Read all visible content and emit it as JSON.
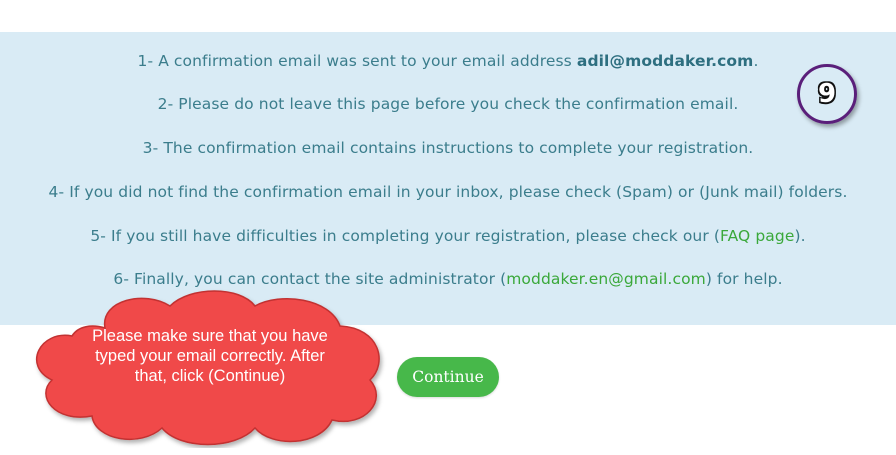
{
  "instructions": {
    "line1_text": "1- A confirmation email was sent to your email address ",
    "line1_email": "adil@moddaker.com",
    "line1_end": ".",
    "line2": "2- Please do not leave this page before you check the confirmation email.",
    "line3": "3- The confirmation email contains instructions to complete your registration.",
    "line4": "4- If you did not find the confirmation email in your inbox, please check (Spam) or (Junk mail) folders.",
    "line5_text": "5- If you still have difficulties in completing your registration, please check our (",
    "line5_link": "FAQ page",
    "line5_end": ").",
    "line6_text": "6- Finally, you can contact the site administrator (",
    "line6_link": "moddaker.en@gmail.com",
    "line6_end": ") for help."
  },
  "step_badge": "9",
  "callout": {
    "text": "Please make sure that you have typed your email correctly. After that, click (Continue)"
  },
  "continue_button_label": "Continue",
  "colors": {
    "panel_background": "#d9ebf5",
    "text": "#3b7d8c",
    "link": "#3aa83a",
    "button": "#47b84a",
    "callout": "#f04848",
    "badge_border": "#5a1f7a"
  }
}
